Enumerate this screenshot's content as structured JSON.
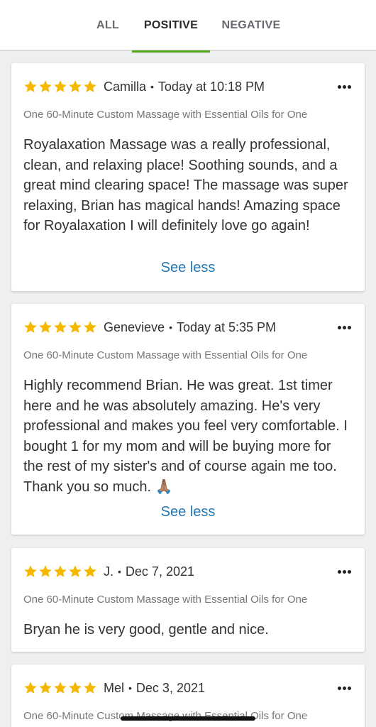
{
  "tabs": [
    {
      "label": "ALL",
      "active": false
    },
    {
      "label": "POSITIVE",
      "active": true
    },
    {
      "label": "NEGATIVE",
      "active": false
    }
  ],
  "colors": {
    "accent": "#53a318",
    "star": "#f5b800",
    "link": "#1f78b4"
  },
  "reviews": [
    {
      "name": "Camilla",
      "separator": "•",
      "date": "Today at 10:18 PM",
      "rating": 5,
      "deal": "One 60-Minute Custom Massage with Essential Oils for One",
      "text": "Royalaxation Massage was a really professional, clean, and relaxing place! Soothing sounds, and a great mind clearing space! The massage was super relaxing, Brian has magical hands! Amazing space for Royalaxation I will definitely love go again!",
      "toggle_label": "See less"
    },
    {
      "name": "Genevieve",
      "separator": "•",
      "date": "Today at 5:35 PM",
      "rating": 5,
      "deal": "One 60-Minute Custom Massage with Essential Oils for One",
      "text": "Highly recommend Brian. He was great. 1st timer here and he was absolutely amazing. He's very professional and makes you feel very comfortable. I bought 1 for my mom and will be buying more for the rest of my sister's and of course again me too. Thank you so much. 🙏🏽",
      "toggle_label": "See less"
    },
    {
      "name": "J.",
      "separator": "•",
      "date": "Dec 7, 2021",
      "rating": 5,
      "deal": "One 60-Minute Custom Massage with Essential Oils for One",
      "text": "Bryan he is very good, gentle and nice."
    },
    {
      "name": "Mel",
      "separator": "•",
      "date": "Dec 3, 2021",
      "rating": 5,
      "deal": "One 60-Minute Custom Massage with Essential Oils for One"
    }
  ]
}
